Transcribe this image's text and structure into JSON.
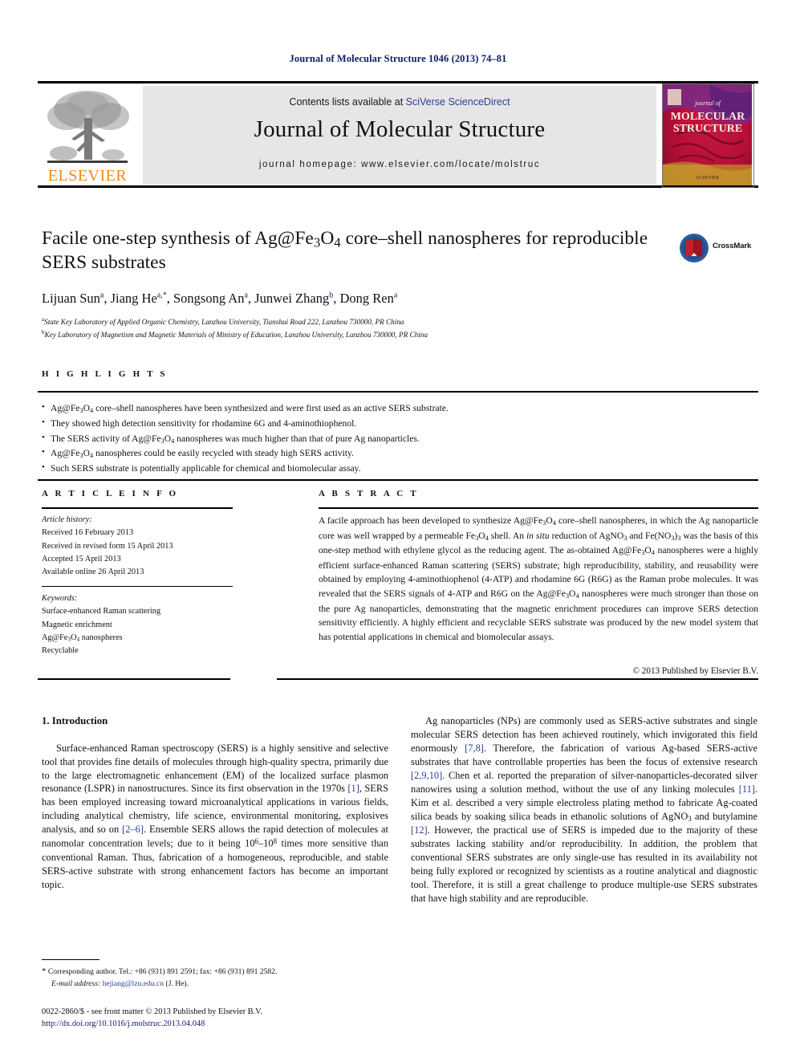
{
  "running_head": "Journal of Molecular Structure 1046 (2013) 74–81",
  "masthead": {
    "contents_prefix": "Contents lists available at ",
    "sciencedirect": "SciVerse ScienceDirect",
    "journal_title": "Journal of Molecular Structure",
    "homepage": "journal homepage: www.elsevier.com/locate/molstruc",
    "publisher_wordmark": "ELSEVIER",
    "cover_line1": "journal of",
    "cover_line2": "MOLECULAR",
    "cover_line3": "STRUCTURE",
    "accent_orange": "#f08a1c",
    "link_blue": "#2d3c91",
    "banner_gray": "#e6e6e6"
  },
  "article": {
    "title_part1": "Facile one-step synthesis of Ag@Fe",
    "title_sub1": "3",
    "title_part2": "O",
    "title_sub2": "4",
    "title_part3": " core–shell nanospheres for reproducible SERS substrates",
    "authors": [
      {
        "name": "Lijuan Sun",
        "mark": "a",
        "sep": ", "
      },
      {
        "name": "Jiang He",
        "mark": "a,*",
        "sep": ", "
      },
      {
        "name": "Songsong An",
        "mark": "a",
        "sep": ", "
      },
      {
        "name": "Junwei Zhang",
        "mark": "b",
        "sep": ", "
      },
      {
        "name": "Dong Ren",
        "mark": "a",
        "sep": ""
      }
    ],
    "affiliations": [
      {
        "mark": "a",
        "text": "State Key Laboratory of Applied Organic Chemistry, Lanzhou University, Tianshui Road 222, Lanzhou 730000, PR China"
      },
      {
        "mark": "b",
        "text": "Key Laboratory of Magnetism and Magnetic Materials of Ministry of Education, Lanzhou University, Lanzhou 730000, PR China"
      }
    ],
    "crossmark_label": "CrossMark"
  },
  "highlights": {
    "heading": "H I G H L I G H T S",
    "items": [
      "Ag@Fe3O4 core–shell nanospheres have been synthesized and were first used as an active SERS substrate.",
      "They showed high detection sensitivity for rhodamine 6G and 4-aminothiophenol.",
      "The SERS activity of Ag@Fe3O4 nanospheres was much higher than that of pure Ag nanoparticles.",
      "Ag@Fe3O4 nanospheres could be easily recycled with steady high SERS activity.",
      "Such SERS substrate is potentially applicable for chemical and biomolecular assay."
    ]
  },
  "article_info": {
    "heading": "A R T I C L E   I N F O",
    "history_label": "Article history:",
    "history": [
      "Received 16 February 2013",
      "Received in revised form 15 April 2013",
      "Accepted 15 April 2013",
      "Available online 26 April 2013"
    ],
    "keywords_label": "Keywords:",
    "keywords": [
      "Surface-enhanced Raman scattering",
      "Magnetic enrichment",
      "Ag@Fe3O4 nanospheres",
      "Recyclable"
    ]
  },
  "abstract": {
    "heading": "A B S T R A C T",
    "text": "A facile approach has been developed to synthesize Ag@Fe3O4 core–shell nanospheres, in which the Ag nanoparticle core was well wrapped by a permeable Fe3O4 shell. An in situ reduction of AgNO3 and Fe(NO3)3 was the basis of this one-step method with ethylene glycol as the reducing agent. The as-obtained Ag@Fe3O4 nanospheres were a highly efficient surface-enhanced Raman scattering (SERS) substrate; high reproducibility, stability, and reusability were obtained by employing 4-aminothiophenol (4-ATP) and rhodamine 6G (R6G) as the Raman probe molecules. It was revealed that the SERS signals of 4-ATP and R6G on the Ag@Fe3O4 nanospheres were much stronger than those on the pure Ag nanoparticles, demonstrating that the magnetic enrichment procedures can improve SERS detection sensitivity efficiently. A highly efficient and recyclable SERS substrate was produced by the new model system that has potential applications in chemical and biomolecular assays.",
    "copyright": "© 2013 Published by Elsevier B.V."
  },
  "body": {
    "section_title": "1. Introduction",
    "left_paragraph_1": "Surface-enhanced Raman spectroscopy (SERS) is a highly sensitive and selective tool that provides fine details of molecules through high-quality spectra, primarily due to the large electromagnetic enhancement (EM) of the localized surface plasmon resonance (LSPR) in nanostructures. Since its first observation in the 1970s [1], SERS has been employed increasing toward microanalytical applications in various fields, including analytical chemistry, life science, environmental monitoring, explosives analysis, and so on [2–6]. Ensemble SERS allows the rapid detection of molecules at nanomolar concentration levels; due to it being 10⁶–10⁸ times more sensitive than conventional Raman. Thus, fabrication of a homogeneous, reproducible, and stable SERS-active substrate with strong enhancement factors has become an important topic.",
    "right_paragraph_1": "Ag nanoparticles (NPs) are commonly used as SERS-active substrates and single molecular SERS detection has been achieved routinely, which invigorated this field enormously [7,8]. Therefore, the fabrication of various Ag-based SERS-active substrates that have controllable properties has been the focus of extensive research [2,9,10]. Chen et al. reported the preparation of silver-nanoparticles-decorated silver nanowires using a solution method, without the use of any linking molecules [11]. Kim et al. described a very simple electroless plating method to fabricate Ag-coated silica beads by soaking silica beads in ethanolic solutions of AgNO3 and butylamine [12]. However, the practical use of SERS is impeded due to the majority of these substrates lacking stability and/or reproducibility. In addition, the problem that conventional SERS substrates are only single-use has resulted in its availability not being fully explored or recognized by scientists as a routine analytical and diagnostic tool. Therefore, it is still a great challenge to produce multiple-use SERS substrates that have high stability and are reproducible."
  },
  "footer": {
    "corresponding_star": "*",
    "corresponding": "Corresponding author. Tel.: +86 (931) 891 2591; fax: +86 (931) 891 2582.",
    "email_label": "E-mail address:",
    "email": "hejiang@lzu.edu.cn",
    "email_owner": "(J. He).",
    "front_matter": "0022-2860/$ - see front matter © 2013 Published by Elsevier B.V.",
    "doi": "http://dx.doi.org/10.1016/j.molstruc.2013.04.048"
  }
}
